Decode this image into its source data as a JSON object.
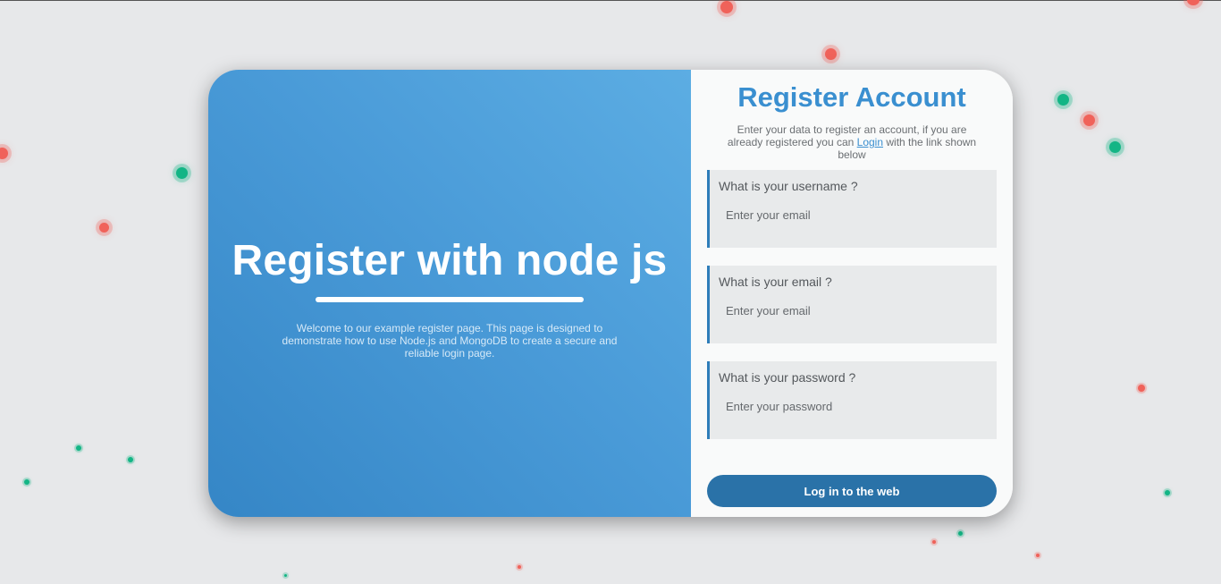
{
  "hero": {
    "title": "Register with node js",
    "description": "Welcome to our example register page. This page is designed to demonstrate how to use Node.js and MongoDB to create a secure and reliable login page."
  },
  "form": {
    "title": "Register Account",
    "intro_before": "Enter your data to register an account, if you are already registered you can ",
    "intro_link": "Login",
    "intro_after": " with the link shown below",
    "fields": [
      {
        "label": "What is your username ?",
        "placeholder": "Enter your email",
        "value": ""
      },
      {
        "label": "What is your email ?",
        "placeholder": "Enter your email",
        "value": ""
      },
      {
        "label": "What is your password ?",
        "placeholder": "Enter your password",
        "value": ""
      }
    ],
    "submit_label": "Log in to the web"
  },
  "colors": {
    "accent": "#3a8fd0",
    "button": "#2a72a8",
    "particle_red": "#f0625a",
    "particle_green": "#13b585"
  }
}
